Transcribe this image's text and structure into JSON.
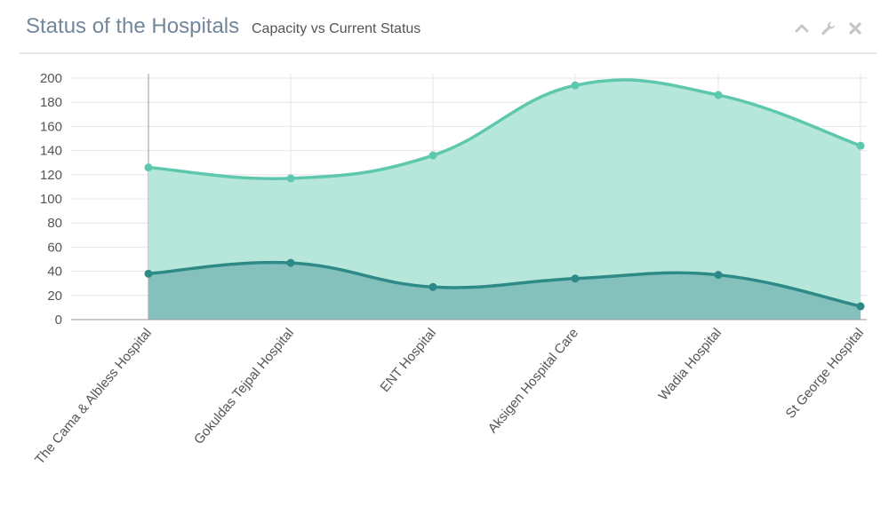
{
  "panel": {
    "title": "Status of the Hospitals",
    "subtitle": "Capacity vs Current Status",
    "tools": [
      {
        "icon": "chevron-up-icon"
      },
      {
        "icon": "wrench-icon"
      },
      {
        "icon": "close-icon"
      }
    ]
  },
  "colors": {
    "capacity_line": "#5dc8ad",
    "capacity_fill": "#b7e6db",
    "current_line": "#2e8a87",
    "current_fill": "#84c1bc",
    "grid": "#e6e6e6",
    "tick_text": "#555555",
    "title": "#73879c",
    "tool_icon": "#c5c7cb"
  },
  "chart_data": {
    "type": "area",
    "title": "",
    "xlabel": "",
    "ylabel": "",
    "ylim": [
      0,
      200
    ],
    "y_ticks": [
      0,
      20,
      40,
      60,
      80,
      100,
      120,
      140,
      160,
      180,
      200
    ],
    "grid": true,
    "categories": [
      "The Cama & Albless Hospital",
      "Gokuldas Tejpal Hospital",
      "ENT Hospital",
      "Aksigen Hospital Care",
      "Wadia Hospital",
      "St George Hospital"
    ],
    "series": [
      {
        "values": [
          126,
          117,
          136,
          194,
          186,
          144
        ]
      },
      {
        "values": [
          38,
          47,
          27,
          34,
          37,
          11
        ]
      }
    ]
  }
}
